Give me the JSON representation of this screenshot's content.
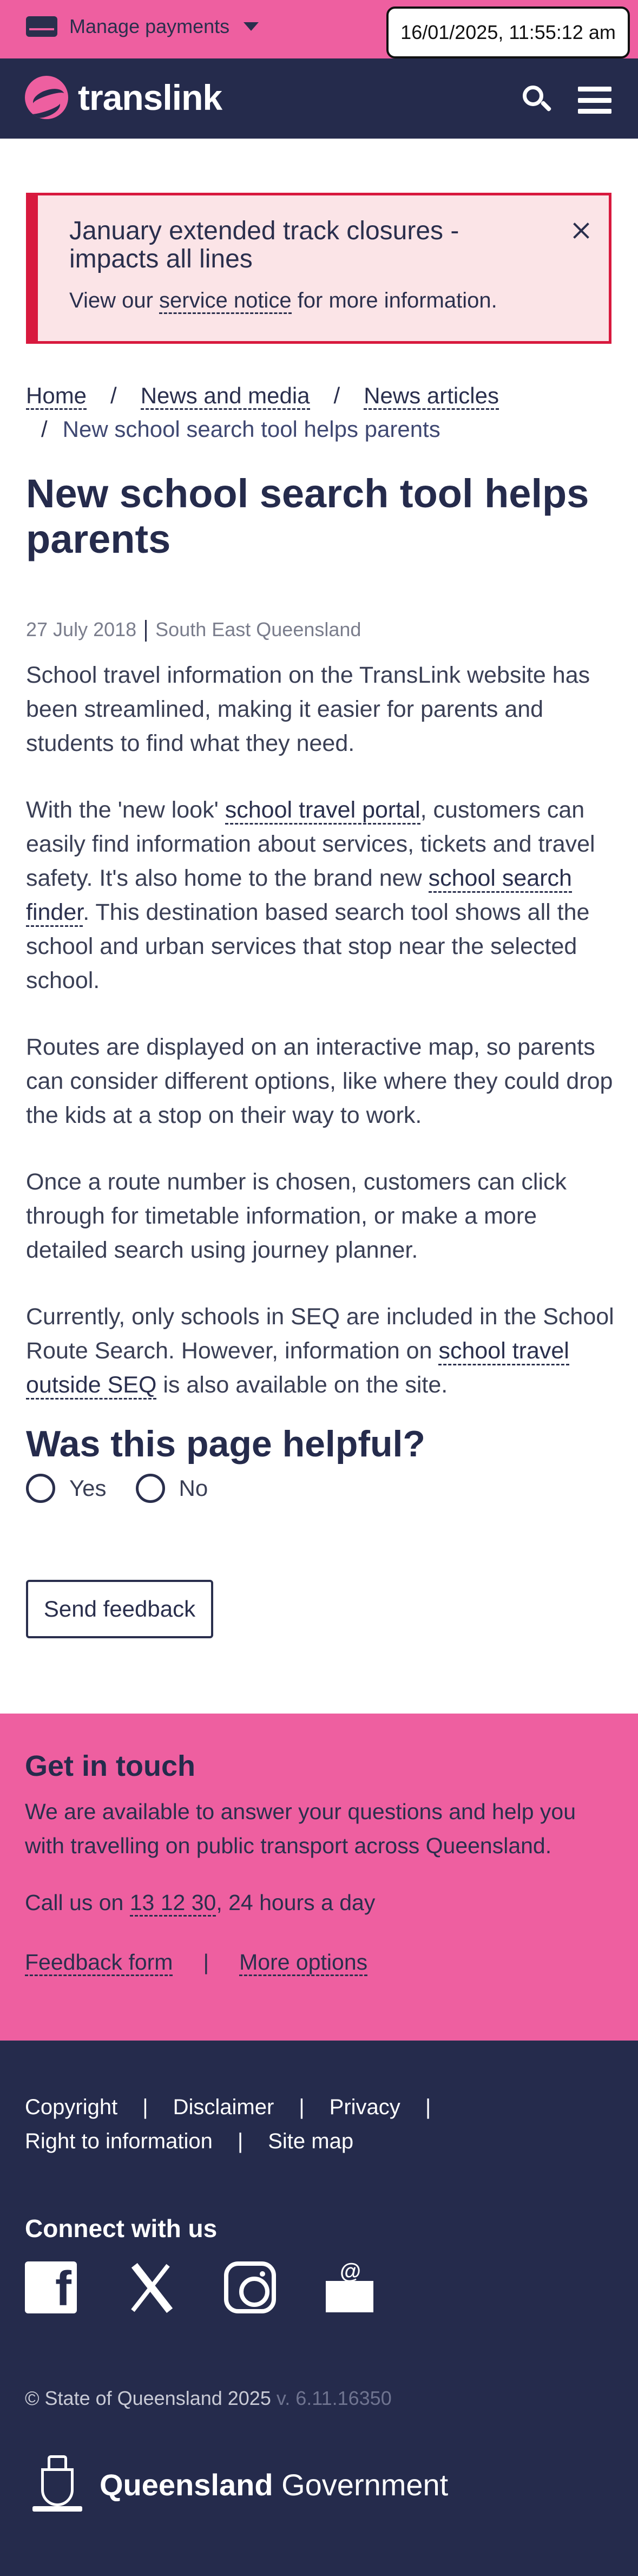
{
  "utility": {
    "manage_payments": "Manage payments",
    "timestamp": "16/01/2025, 11:55:12 am"
  },
  "header": {
    "logo_text": "translink",
    "icons": [
      "search-icon",
      "menu-icon"
    ]
  },
  "alert": {
    "title": "January extended track closures - impacts all lines",
    "body_prefix": "View our ",
    "body_link": "service notice",
    "body_suffix": " for more information."
  },
  "breadcrumb": {
    "items": [
      "Home",
      "News and media",
      "News articles"
    ],
    "separator": "/",
    "current": "New school search tool helps parents"
  },
  "article": {
    "title": "New school search tool helps parents",
    "date": "27 July 2018",
    "region": "South East Queensland",
    "p1": "School travel information on the TransLink website has been streamlined, making it easier for parents and students to find what they need.",
    "p2_a": "With the 'new look' ",
    "p2_link1": "school travel portal",
    "p2_b": ", customers can easily find information about services, tickets and travel safety. It's also home to the brand new ",
    "p2_link2": "school search finder",
    "p2_c": ". This destination based search tool shows all the school and urban services that stop near the selected school.",
    "p3": "Routes are displayed on an interactive map, so parents can consider different options, like where they could drop the kids at a stop on their way to work.",
    "p4": "Once a route number is chosen, customers can click through for timetable information, or make a more detailed search using journey planner.",
    "p5_a": "Currently, only schools in SEQ are included in the School Route Search. However, information on ",
    "p5_link": "school travel outside SEQ",
    "p5_b": " is also available on the site."
  },
  "feedback": {
    "heading": "Was this page helpful?",
    "yes": "Yes",
    "no": "No",
    "button": "Send feedback"
  },
  "contact": {
    "heading": "Get in touch",
    "desc": "We are available to answer your questions and help you with travelling on public transport across Queensland.",
    "call_prefix": "Call us on ",
    "phone": "13 12 30",
    "call_suffix": ", 24 hours a day",
    "feedback_form": "Feedback form",
    "separator": "|",
    "more_options": "More options"
  },
  "footer": {
    "links": [
      "Copyright",
      "Disclaimer",
      "Privacy",
      "Right to information",
      "Site map"
    ],
    "separator": "|",
    "connect_heading": "Connect with us",
    "social_icons": [
      "facebook-icon",
      "x-icon",
      "instagram-icon",
      "email-icon"
    ],
    "copyright": "© State of Queensland 2025",
    "version": "v. 6.11.16350",
    "gov_bold": "Queensland",
    "gov_light": " Government"
  },
  "colors": {
    "pink": "#ee5fa0",
    "navy": "#252b4c",
    "alert_red": "#d8193e",
    "alert_bg": "#fbe4e7"
  }
}
